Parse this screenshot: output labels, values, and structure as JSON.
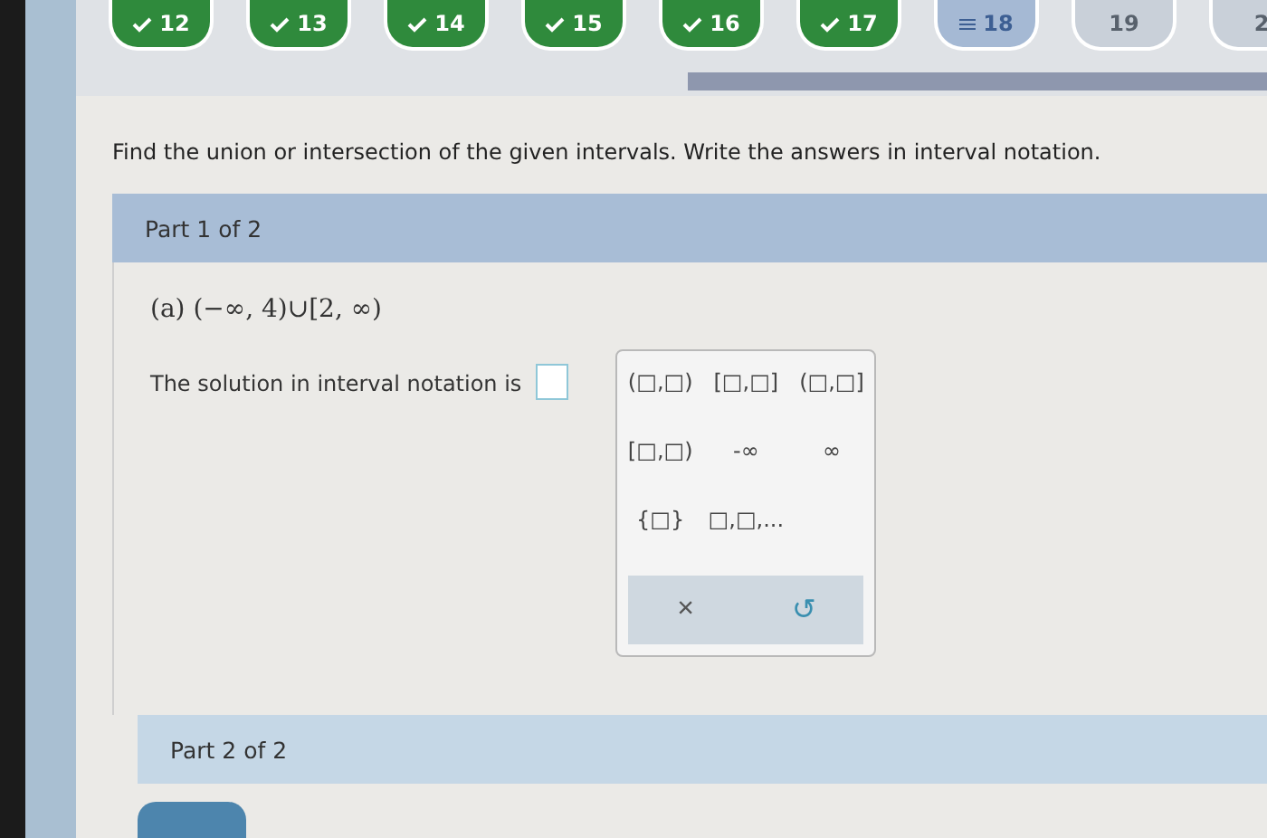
{
  "question_nav": [
    {
      "label": "12",
      "checked": true,
      "selected": false
    },
    {
      "label": "13",
      "checked": true,
      "selected": false
    },
    {
      "label": "14",
      "checked": true,
      "selected": false
    },
    {
      "label": "15",
      "checked": true,
      "selected": false
    },
    {
      "label": "16",
      "checked": true,
      "selected": false
    },
    {
      "label": "17",
      "checked": true,
      "selected": false
    },
    {
      "label": "18",
      "checked": false,
      "selected": true
    },
    {
      "label": "19",
      "checked": false,
      "selected": false
    },
    {
      "label": "2",
      "checked": false,
      "selected": false
    }
  ],
  "instructions": "Find the union or intersection of the given intervals. Write the answers in interval notation.",
  "parts": [
    {
      "header": "Part 1 of 2",
      "problem": "(a) (−∞, 4)∪[2, ∞)",
      "prompt": "The solution in interval notation is",
      "palette": {
        "keys": [
          "(□,□)",
          "[□,□]",
          "(□,□]",
          "[□,□)",
          "-∞",
          "∞",
          "{□}",
          "□,□,..."
        ],
        "actions": [
          {
            "kind": "clear",
            "label": "×"
          },
          {
            "kind": "undo",
            "label": "↺"
          }
        ]
      }
    },
    {
      "header": "Part 2 of 2"
    }
  ]
}
